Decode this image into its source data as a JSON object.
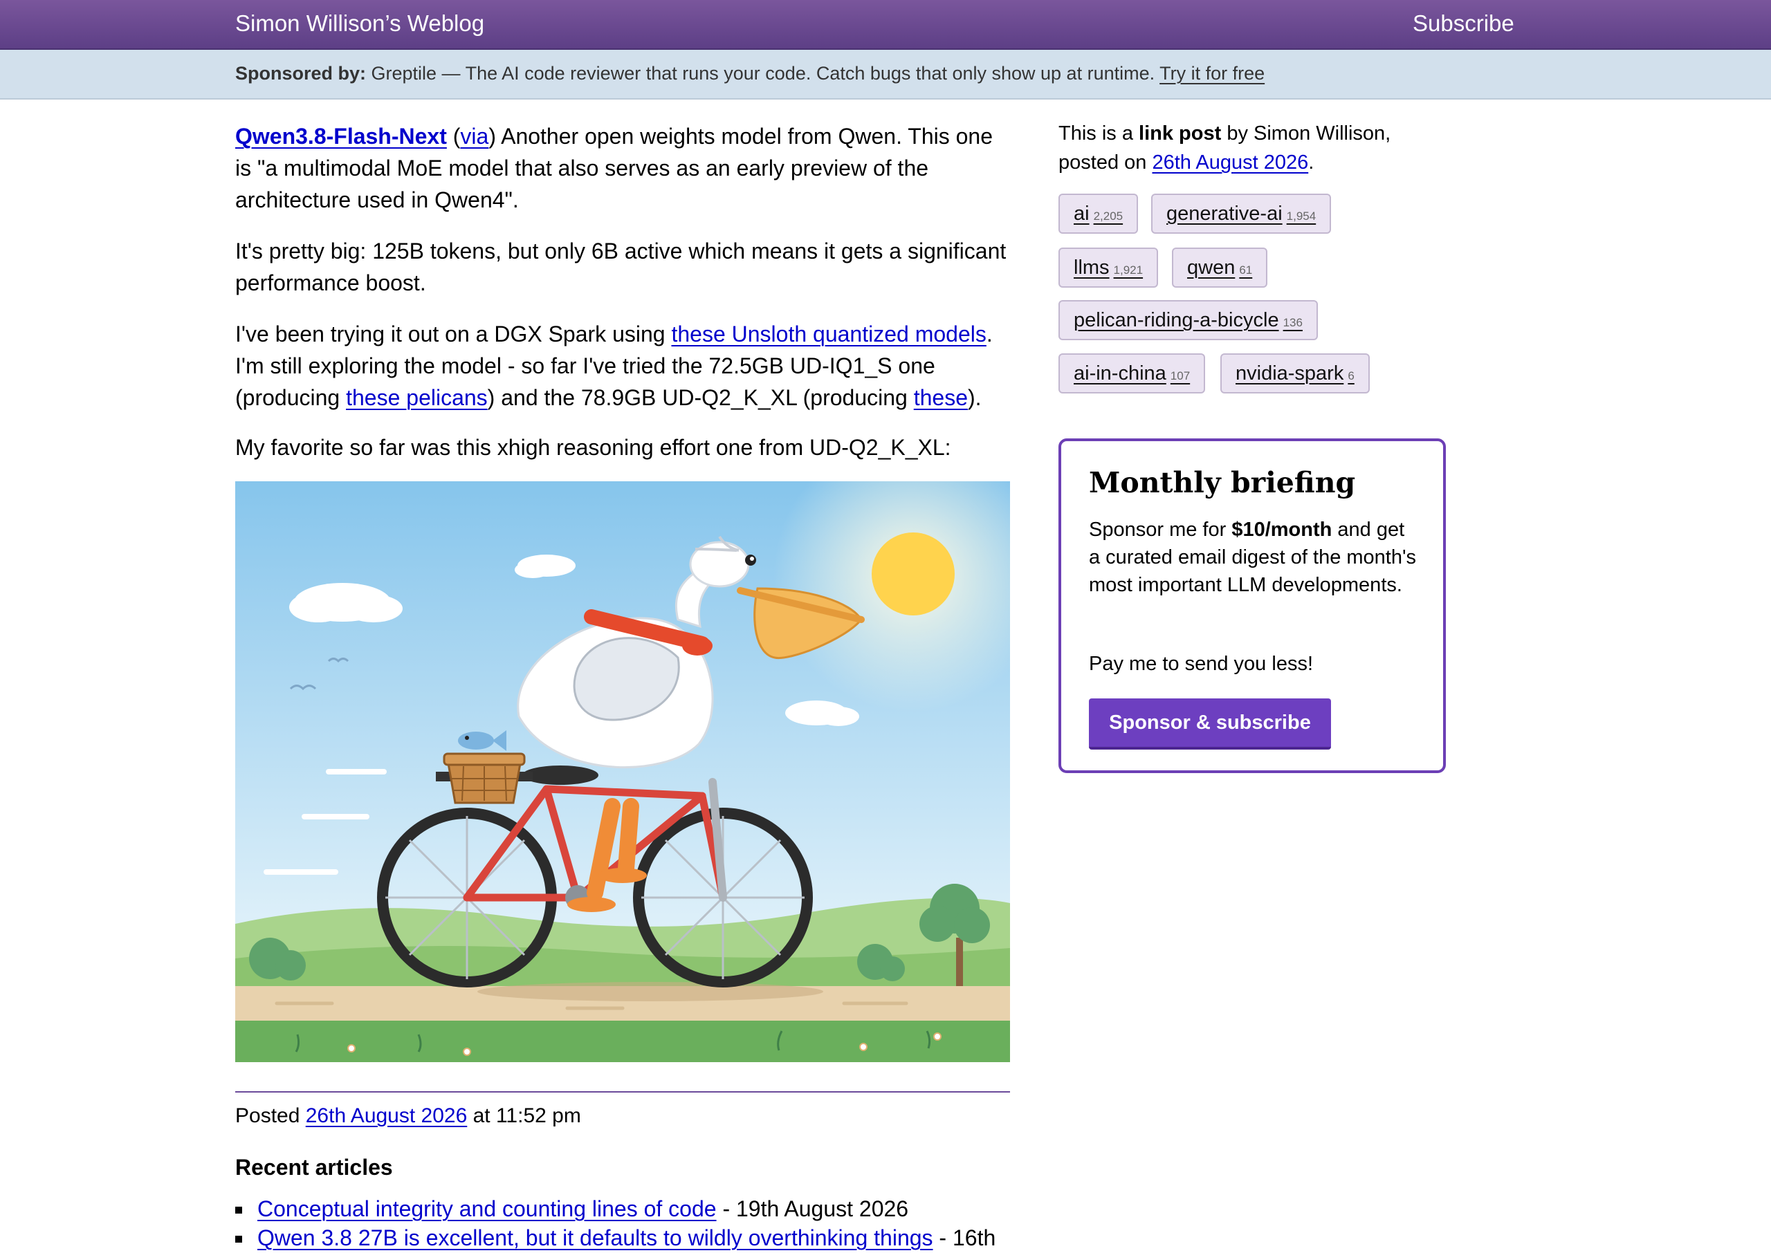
{
  "header": {
    "site_title": "Simon Willison’s Weblog",
    "subscribe_label": "Subscribe"
  },
  "sponsor_bar": {
    "label": "Sponsored by:",
    "text": " Greptile — The AI code reviewer that runs your code. Catch bugs that only show up at runtime. ",
    "cta": "Try it for free"
  },
  "post": {
    "title_link": "Qwen3.8-Flash-Next",
    "via_open": " (",
    "via_label": "via",
    "p1_rest": ") Another open weights model from Qwen. This one is \"a multimodal MoE model that also serves as an early preview of the architecture used in Qwen4\".",
    "p2": "It's pretty big: 125B tokens, but only 6B active which means it gets a significant performance boost.",
    "p3_a": "I've been trying it out on a DGX Spark using ",
    "p3_link1": "these Unsloth quantized models",
    "p3_b": ". I'm still exploring the model - so far I've tried the 72.5GB UD-IQ1_S one (producing ",
    "p3_link2": "these pelicans",
    "p3_c": ") and the 78.9GB UD-Q2_K_XL (producing ",
    "p3_link3": "these",
    "p3_d": ").",
    "p4": "My favorite so far was this xhigh reasoning effort one from UD-Q2_K_XL:",
    "posted_prefix": "Posted ",
    "posted_date": "26th August 2026",
    "posted_time": " at 11:52 pm"
  },
  "recent": {
    "heading": "Recent articles",
    "items": [
      {
        "title": "Conceptual integrity and counting lines of code",
        "date": " - 19th August 2026"
      },
      {
        "title": "Qwen 3.8 27B is excellent, but it defaults to wildly overthinking things",
        "date": " - 16th"
      }
    ]
  },
  "sidebar": {
    "intro_a": "This is a ",
    "intro_bold": "link post",
    "intro_b": " by Simon Willison, posted on ",
    "intro_date": "26th August 2026",
    "intro_end": ".",
    "tags": [
      {
        "name": "ai",
        "count": "2,205"
      },
      {
        "name": "generative-ai",
        "count": "1,954"
      },
      {
        "name": "llms",
        "count": "1,921"
      },
      {
        "name": "qwen",
        "count": "61"
      },
      {
        "name": "pelican-riding-a-bicycle",
        "count": "136"
      },
      {
        "name": "ai-in-china",
        "count": "107"
      },
      {
        "name": "nvidia-spark",
        "count": "6"
      }
    ]
  },
  "briefing": {
    "title": "Monthly briefing",
    "body_a": "Sponsor me for ",
    "body_bold": "$10/month",
    "body_b": " and get a curated email digest of the month's most important LLM developments.",
    "body2": "Pay me to send you less!",
    "button": "Sponsor & subscribe"
  },
  "colors": {
    "header": "#6a4a92",
    "sponsor_bar": "#d2e0ec",
    "link": "#0000cc",
    "accent": "#6d3fc0"
  }
}
